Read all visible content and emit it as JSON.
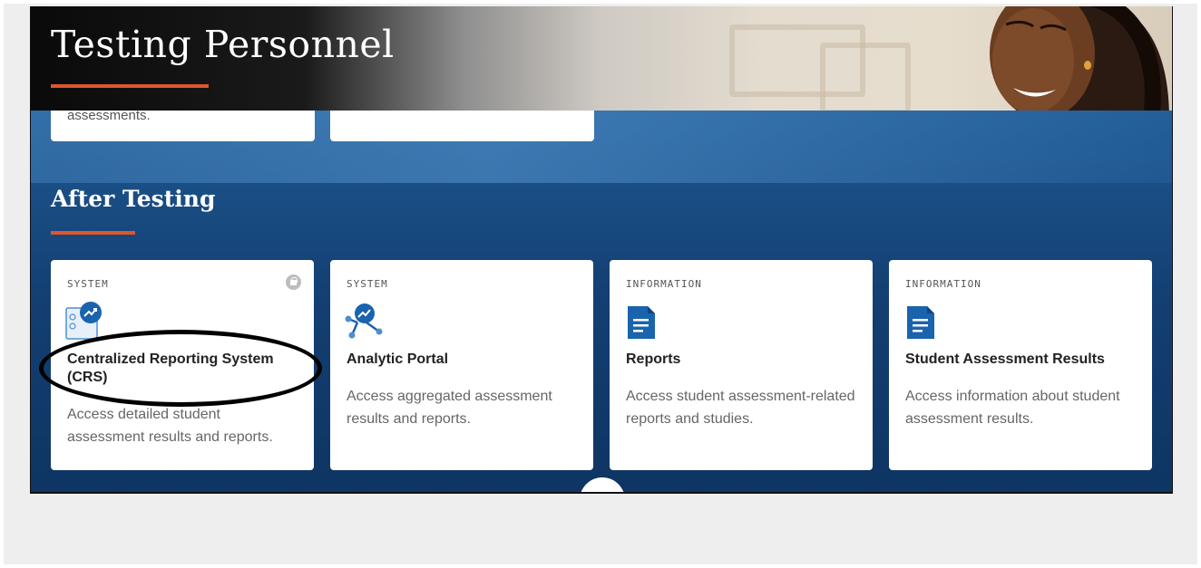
{
  "banner": {
    "title": "Testing Personnel"
  },
  "partial_cards": [
    {
      "text": "assessments."
    },
    {
      "text": ""
    }
  ],
  "section": {
    "title": "After Testing"
  },
  "cards": [
    {
      "tag": "SYSTEM",
      "icon": "chart-document-icon",
      "title": "Centralized Reporting System (CRS)",
      "description": "Access detailed student assessment results and reports.",
      "locked": true
    },
    {
      "tag": "SYSTEM",
      "icon": "network-analytics-icon",
      "title": "Analytic Portal",
      "description": "Access aggregated assessment results and reports."
    },
    {
      "tag": "INFORMATION",
      "icon": "document-icon",
      "title": "Reports",
      "description": "Access student assessment-related reports and studies."
    },
    {
      "tag": "INFORMATION",
      "icon": "document-icon",
      "title": "Student Assessment Results",
      "description": "Access information about student assessment results."
    }
  ],
  "colors": {
    "accent": "#e0552b",
    "primary": "#1a63ad",
    "background": "#1c578f"
  }
}
